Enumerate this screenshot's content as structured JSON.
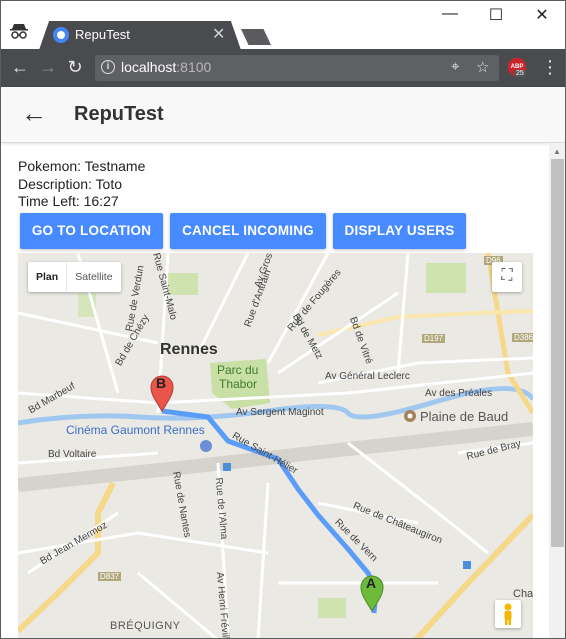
{
  "browser": {
    "tab_title": "RepuTest",
    "tab_close": "✕",
    "url_host": "localhost",
    "url_port": ":8100",
    "abp_label": "ABP",
    "abp_count": "25",
    "window_controls": [
      "—",
      "☐",
      "✕"
    ]
  },
  "app": {
    "back_icon": "←",
    "title": "RepuTest"
  },
  "info": {
    "pokemon": "Pokemon: Testname",
    "description": "Description: Toto",
    "time_left": "Time Left: 16:27"
  },
  "buttons": {
    "go_to_location": "GO TO LOCATION",
    "cancel_incoming": "CANCEL INCOMING",
    "display_users": "DISPLAY USERS"
  },
  "map": {
    "toggle_plan": "Plan",
    "toggle_satellite": "Satellite",
    "marker_a": "A",
    "marker_b": "B",
    "labels": {
      "rennes": "Rennes",
      "parc": "Parc du",
      "thabor": "Thabor",
      "plaine": "Plaine de Baud",
      "cinema": "Cinéma Gaumont Rennes",
      "av_sergent": "Av Sergent Maginot",
      "av_leclerc": "Av Général Leclerc",
      "av_prealles": "Av des Préales",
      "rue_bray": "Rue de Bray",
      "bd_voltaire": "Bd Voltaire",
      "bd_marbeuf": "Bd Marbeuf",
      "rue_chateaugiron": "Rue de Châteaugiron",
      "rue_saint_helier": "Rue Saint-Hélier",
      "rue_vern": "Rue de Vern",
      "bd_jean_mermoz": "Bd Jean Mermoz",
      "brequigny": "BRÉQUIGNY",
      "rue_verdun": "Rue de Verdun",
      "bd_chezy": "Bd de Chézy",
      "rue_saint_malo": "Rue Saint-Malo",
      "rue_antrain": "Rue d'Antrain",
      "rue_fougeres": "Rue de Fougères",
      "bd_vitre": "Bd de Vitré",
      "bd_metz": "Bd de Metz",
      "rue_alma": "Rue de l'Alma",
      "rue_nantes": "Rue de Nantes",
      "av_henri_freville": "Av Henri Fréville",
      "av_gros": "Av Gros",
      "cha": "Cha",
      "d96": "D96",
      "d197": "D197",
      "d386": "D386",
      "d837": "D837"
    },
    "colors": {
      "route": "#5a9cf8",
      "marker_a": "#6dbb3b",
      "marker_b": "#e9554a",
      "park": "#c8dfa6"
    }
  }
}
